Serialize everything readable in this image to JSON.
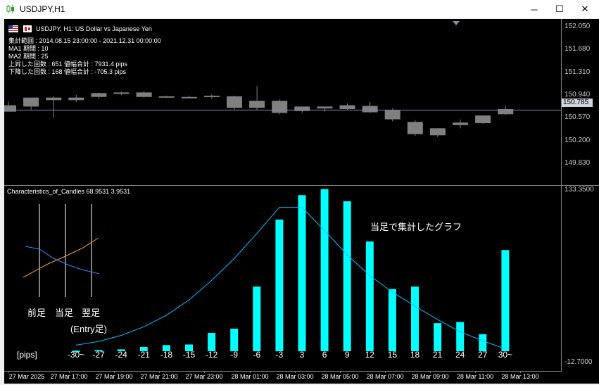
{
  "window": {
    "title": "USDJPY,H1"
  },
  "window_buttons": {
    "minimize": "─",
    "maximize": "☐",
    "close": "✕"
  },
  "main_chart": {
    "symbol_line": "USDJPY, H1:  US Dollar vs Japanese Yen",
    "info": [
      "集計範囲 : 2014.08.15 23:00:00 - 2021.12.31 00:00:00",
      "MA1 期間 : 10",
      "MA2 期間 : 25",
      "上昇した回数 : 651  値幅合計 : 7931.4 pips",
      "下降した回数 : 168  値幅合計 : -705.3 pips"
    ],
    "price_axis": [
      "152.050",
      "151.680",
      "151.310",
      "150.940",
      "150.570",
      "150.200",
      "149.830"
    ],
    "current_price": "150.785",
    "candles": [
      {
        "o": 150.86,
        "h": 150.92,
        "l": 150.76,
        "c": 150.76
      },
      {
        "o": 150.84,
        "h": 150.97,
        "l": 150.79,
        "c": 150.98
      },
      {
        "o": 150.98,
        "h": 151.0,
        "l": 150.67,
        "c": 150.94
      },
      {
        "o": 150.94,
        "h": 151.02,
        "l": 150.91,
        "c": 150.98
      },
      {
        "o": 150.99,
        "h": 151.06,
        "l": 150.96,
        "c": 151.05
      },
      {
        "o": 151.05,
        "h": 151.07,
        "l": 151.02,
        "c": 151.06
      },
      {
        "o": 151.06,
        "h": 151.08,
        "l": 150.98,
        "c": 150.99
      },
      {
        "o": 151.0,
        "h": 151.01,
        "l": 150.98,
        "c": 151.0
      },
      {
        "o": 150.99,
        "h": 151.01,
        "l": 150.97,
        "c": 150.98
      },
      {
        "o": 150.99,
        "h": 151.03,
        "l": 150.96,
        "c": 151.01
      },
      {
        "o": 151.0,
        "h": 151.01,
        "l": 150.79,
        "c": 150.82
      },
      {
        "o": 150.82,
        "h": 151.16,
        "l": 150.78,
        "c": 150.93
      },
      {
        "o": 150.93,
        "h": 150.95,
        "l": 150.72,
        "c": 150.74
      },
      {
        "o": 150.77,
        "h": 150.84,
        "l": 150.74,
        "c": 150.84
      },
      {
        "o": 150.81,
        "h": 150.83,
        "l": 150.76,
        "c": 150.84
      },
      {
        "o": 150.8,
        "h": 150.89,
        "l": 150.78,
        "c": 150.86
      },
      {
        "o": 150.85,
        "h": 150.91,
        "l": 150.74,
        "c": 150.75
      },
      {
        "o": 150.78,
        "h": 150.81,
        "l": 150.61,
        "c": 150.64
      },
      {
        "o": 150.6,
        "h": 150.63,
        "l": 150.38,
        "c": 150.41
      },
      {
        "o": 150.5,
        "h": 150.5,
        "l": 150.36,
        "c": 150.39
      },
      {
        "o": 150.55,
        "h": 150.64,
        "l": 150.5,
        "c": 150.59
      },
      {
        "o": 150.58,
        "h": 150.7,
        "l": 150.57,
        "c": 150.7
      },
      {
        "o": 150.72,
        "h": 150.85,
        "l": 150.71,
        "c": 150.8
      }
    ],
    "price_min": 149.7,
    "price_max": 152.12
  },
  "indicator": {
    "name": "Characteristics_of_Candles 68.9531 3.9531",
    "axis_top": "133.3500",
    "axis_bottom": "-12.7000",
    "annotation": "当足で集計したグラフ",
    "pips_label": "[pips]",
    "diagram_labels": [
      "前足",
      "当足",
      "翌足"
    ],
    "diagram_sublabel": "(Entry足)",
    "colors": {
      "histogram": "#00ffff",
      "curve": "#00bfff",
      "ma1": "#f0a030",
      "ma2": "#2f8cff"
    }
  },
  "time_axis": [
    "27 Mar 2025",
    "27 Mar 17:00",
    "27 Mar 19:00",
    "27 Mar 21:00",
    "27 Mar 23:00",
    "28 Mar 01:00",
    "28 Mar 03:00",
    "28 Mar 05:00",
    "28 Mar 07:00",
    "28 Mar 09:00",
    "28 Mar 11:00",
    "28 Mar 13:00"
  ],
  "chart_data": {
    "type": "bar",
    "categories": [
      "-30~",
      "-27",
      "-24",
      "-21",
      "-18",
      "-15",
      "-12",
      "-9",
      "-6",
      "-3",
      "3",
      "6",
      "9",
      "12",
      "15",
      "18",
      "21",
      "24",
      "27",
      "30~"
    ],
    "values": [
      0.5,
      1.0,
      1.5,
      3.5,
      5.0,
      5.5,
      15.0,
      18.5,
      53.0,
      108.0,
      128.0,
      133.0,
      123.0,
      90.0,
      51.0,
      53.0,
      23.0,
      24.0,
      14.0,
      83.0
    ],
    "curve": [
      5.0,
      8.0,
      13.0,
      20.0,
      29.5,
      42.0,
      58.0,
      76.0,
      96.5,
      118.0,
      118.0,
      99.0,
      79.0,
      62.0,
      48.5,
      37.0,
      26.0,
      16.0,
      8.5,
      2.0
    ],
    "ylim": [
      -12.7,
      133.35
    ]
  }
}
